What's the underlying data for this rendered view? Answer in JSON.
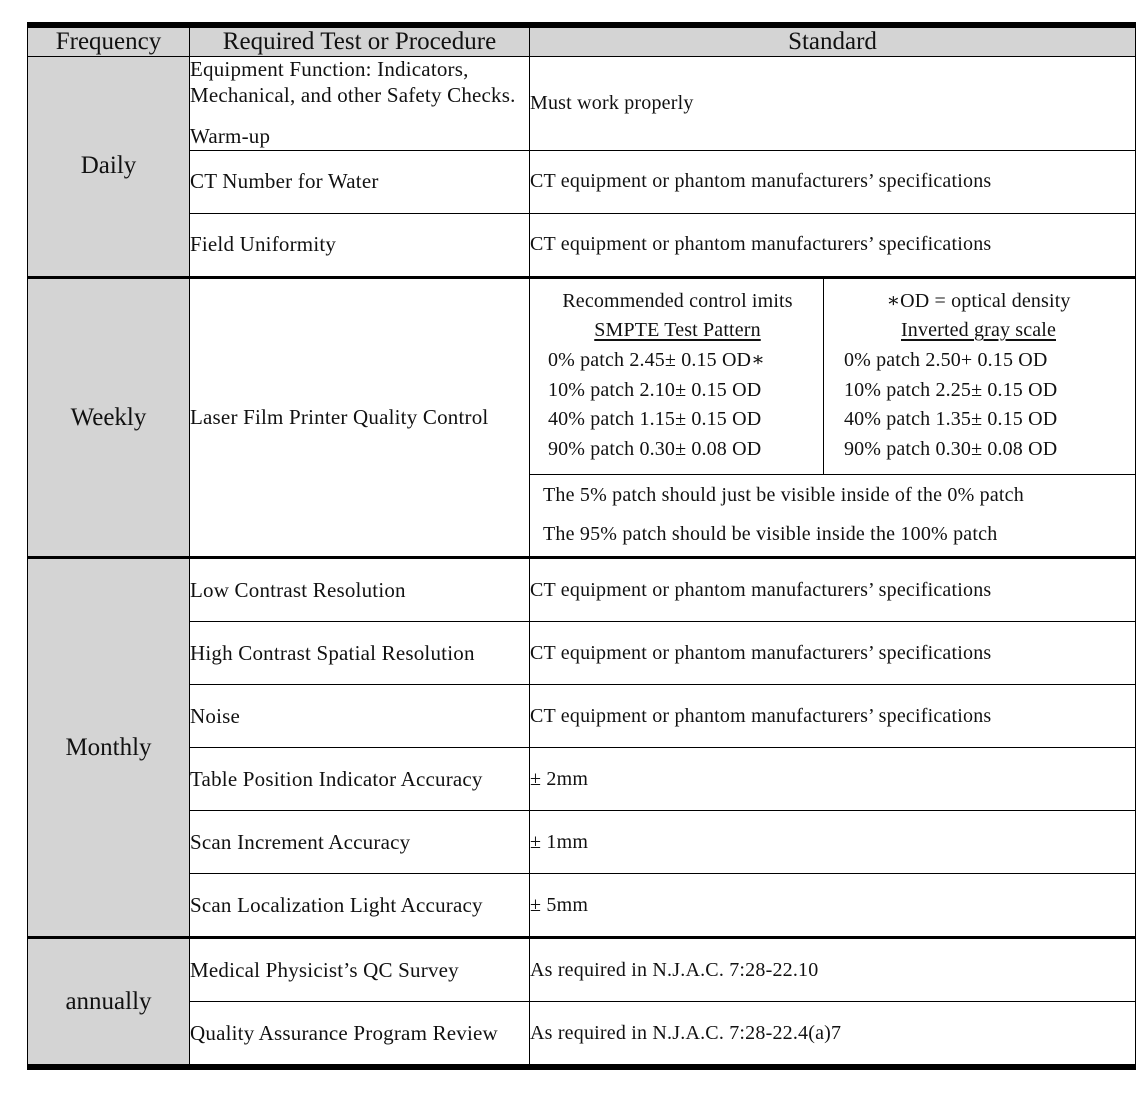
{
  "table": {
    "columns": [
      "Frequency",
      "Required Test or Procedure",
      "Standard"
    ],
    "sections": [
      {
        "frequency": "Daily",
        "rows": [
          {
            "test_lines": [
              "Equipment Function: Indicators, Mechanical, and other Safety Checks.",
              "Warm-up"
            ],
            "standard": "Must work properly"
          },
          {
            "test": "CT Number for Water",
            "standard": "CT equipment or phantom manufacturers’ specifications"
          },
          {
            "test": "Field Uniformity",
            "standard": "CT equipment or phantom manufacturers’ specifications"
          }
        ]
      },
      {
        "frequency": "Weekly",
        "rows": [
          {
            "test": "Laser Film Printer Quality Control",
            "standard_grid": {
              "left": {
                "caption": "Recommended control imits",
                "heading": "SMPTE Test Pattern",
                "lines": [
                  "0% patch 2.45± 0.15 OD∗",
                  "10% patch 2.10± 0.15 OD",
                  "40% patch 1.15± 0.15 OD",
                  "90% patch 0.30± 0.08 OD"
                ]
              },
              "right": {
                "caption": "∗OD = optical density",
                "heading": "Inverted gray scale",
                "lines": [
                  "0% patch 2.50+ 0.15 OD",
                  "10% patch 2.25± 0.15 OD",
                  "40% patch 1.35± 0.15 OD",
                  "90% patch 0.30± 0.08 OD"
                ]
              },
              "notes": [
                "The 5% patch should just be visible inside of the 0% patch",
                "The 95% patch should be visible inside the 100% patch"
              ]
            }
          }
        ]
      },
      {
        "frequency": "Monthly",
        "rows": [
          {
            "test": "Low Contrast Resolution",
            "standard": "CT equipment or phantom manufacturers’ specifications"
          },
          {
            "test": "High Contrast Spatial Resolution",
            "standard": "CT equipment or phantom manufacturers’ specifications"
          },
          {
            "test": "Noise",
            "standard": "CT equipment or phantom manufacturers’ specifications"
          },
          {
            "test": "Table Position Indicator Accuracy",
            "standard": "± 2mm"
          },
          {
            "test": "Scan Increment Accuracy",
            "standard": "± 1mm"
          },
          {
            "test": "Scan Localization Light Accuracy",
            "standard": "± 5mm"
          }
        ]
      },
      {
        "frequency": "annually",
        "rows": [
          {
            "test": "Medical Physicist’s QC Survey",
            "standard": "As required in N.J.A.C. 7:28-22.10"
          },
          {
            "test": "Quality Assurance Program Review",
            "standard": "As required in N.J.A.C. 7:28-22.4(a)7"
          }
        ]
      }
    ]
  },
  "colors": {
    "header_fill": "#d4d4d4",
    "frequency_fill": "#d4d4d4",
    "rule": "#000000",
    "page": "#ffffff"
  }
}
